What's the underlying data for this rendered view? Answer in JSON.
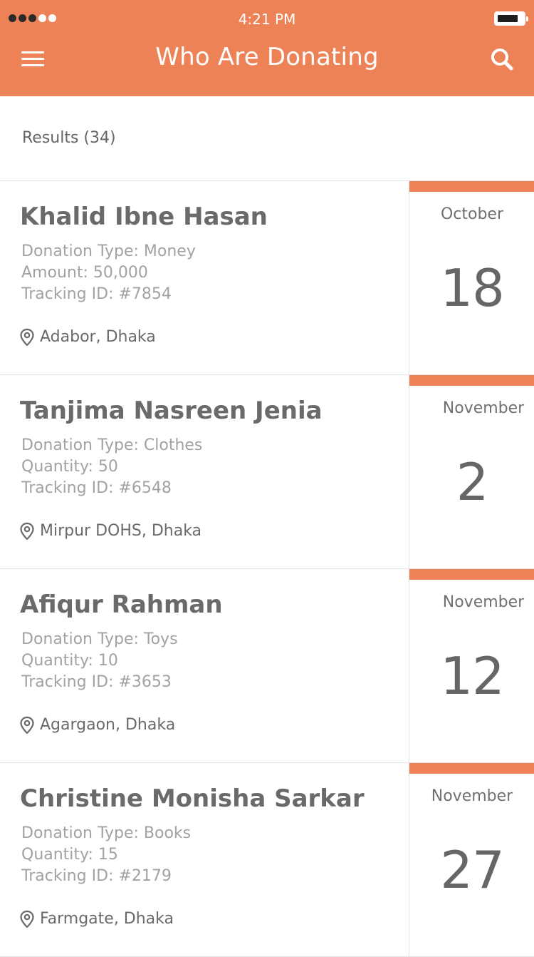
{
  "status_bar": {
    "time": "4:21 PM",
    "signal_dots": [
      "filled",
      "filled",
      "filled",
      "empty",
      "empty"
    ]
  },
  "header": {
    "title": "Who Are Donating",
    "menu_icon": "hamburger-menu-icon",
    "search_icon": "search-icon",
    "background_color": "#ec8256"
  },
  "results": {
    "label": "Results (34)"
  },
  "donations": [
    {
      "name": "Khalid Ibne Hasan",
      "donation_type": "Donation Type: Money",
      "amount": "Amount: 50,000",
      "tracking_id": "Tracking ID: #7854",
      "location": "Adabor, Dhaka",
      "month": "October",
      "day": "18"
    },
    {
      "name": "Tanjima Nasreen Jenia",
      "donation_type": "Donation Type: Clothes",
      "amount": "Quantity: 50",
      "tracking_id": "Tracking ID: #6548",
      "location": "Mirpur DOHS, Dhaka",
      "month": "November",
      "day": "2"
    },
    {
      "name": "Afiqur Rahman",
      "donation_type": "Donation Type: Toys",
      "amount": "Quantity: 10",
      "tracking_id": "Tracking ID: #3653",
      "location": "Agargaon, Dhaka",
      "month": "November",
      "day": "12"
    },
    {
      "name": "Christine Monisha Sarkar",
      "donation_type": "Donation Type: Books",
      "amount": "Quantity: 15",
      "tracking_id": "Tracking ID: #2179",
      "location": "Farmgate, Dhaka",
      "month": "November",
      "day": "27"
    }
  ]
}
